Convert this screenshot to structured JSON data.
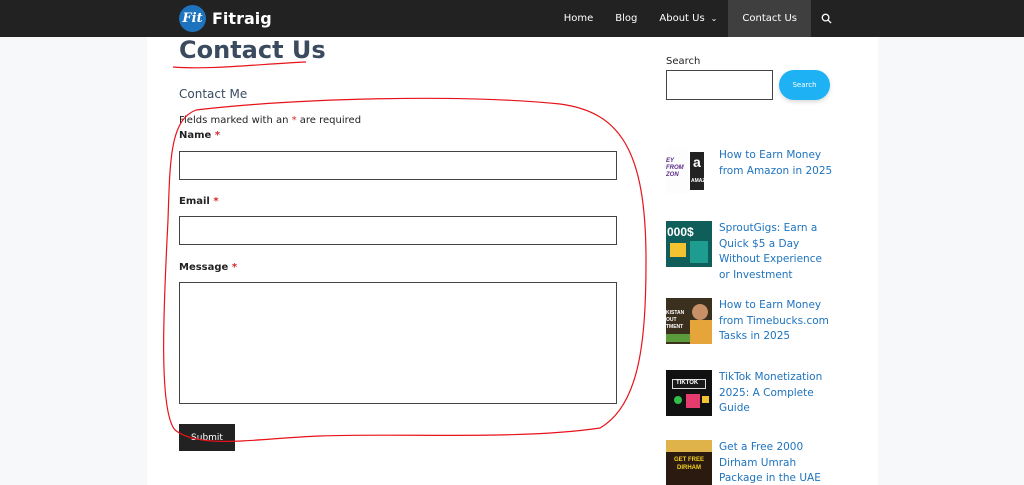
{
  "brand": {
    "logo_text": "Fit",
    "name": "Fitraig"
  },
  "nav": {
    "items": [
      {
        "label": "Home"
      },
      {
        "label": "Blog"
      },
      {
        "label": "About Us",
        "chevron": "⌄"
      },
      {
        "label": "Contact Us"
      }
    ],
    "search_icon": "⌕"
  },
  "page": {
    "title": "Contact Us"
  },
  "form": {
    "heading": "Contact Me",
    "required_note_pre": "Fields marked with an ",
    "required_star": "*",
    "required_note_post": " are required",
    "fields": [
      {
        "label": "Name",
        "star": "*",
        "value": ""
      },
      {
        "label": "Email",
        "star": "*",
        "value": ""
      },
      {
        "label": "Message",
        "star": "*",
        "value": ""
      }
    ],
    "submit_label": "Submit"
  },
  "sidebar": {
    "search_label": "Search",
    "search_button": "Search",
    "posts": [
      {
        "title": "How to Earn Money from Amazon in 2025",
        "thumb_text": "EY FROM ZON",
        "thumb_letter": "a",
        "thumb_sub": "AMAZ"
      },
      {
        "title": "SproutGigs: Earn a Quick $5 a Day Without Experience or Investment",
        "thumb_text": "000$"
      },
      {
        "title": "How to Earn Money from Timebucks.com Tasks in 2025",
        "thumb_text": "KISTAN OUT TMENT"
      },
      {
        "title": "TikTok Monetization 2025: A Complete Guide",
        "thumb_text": "TIKTOK"
      },
      {
        "title": "Get a Free 2000 Dirham Umrah Package in the UAE",
        "thumb_text": "GET FREE DIRHAM"
      }
    ]
  },
  "colors": {
    "accent": "#1e73be",
    "topbar": "#222222",
    "annotation": "#e8131a",
    "search_button": "#1eb2f4"
  }
}
